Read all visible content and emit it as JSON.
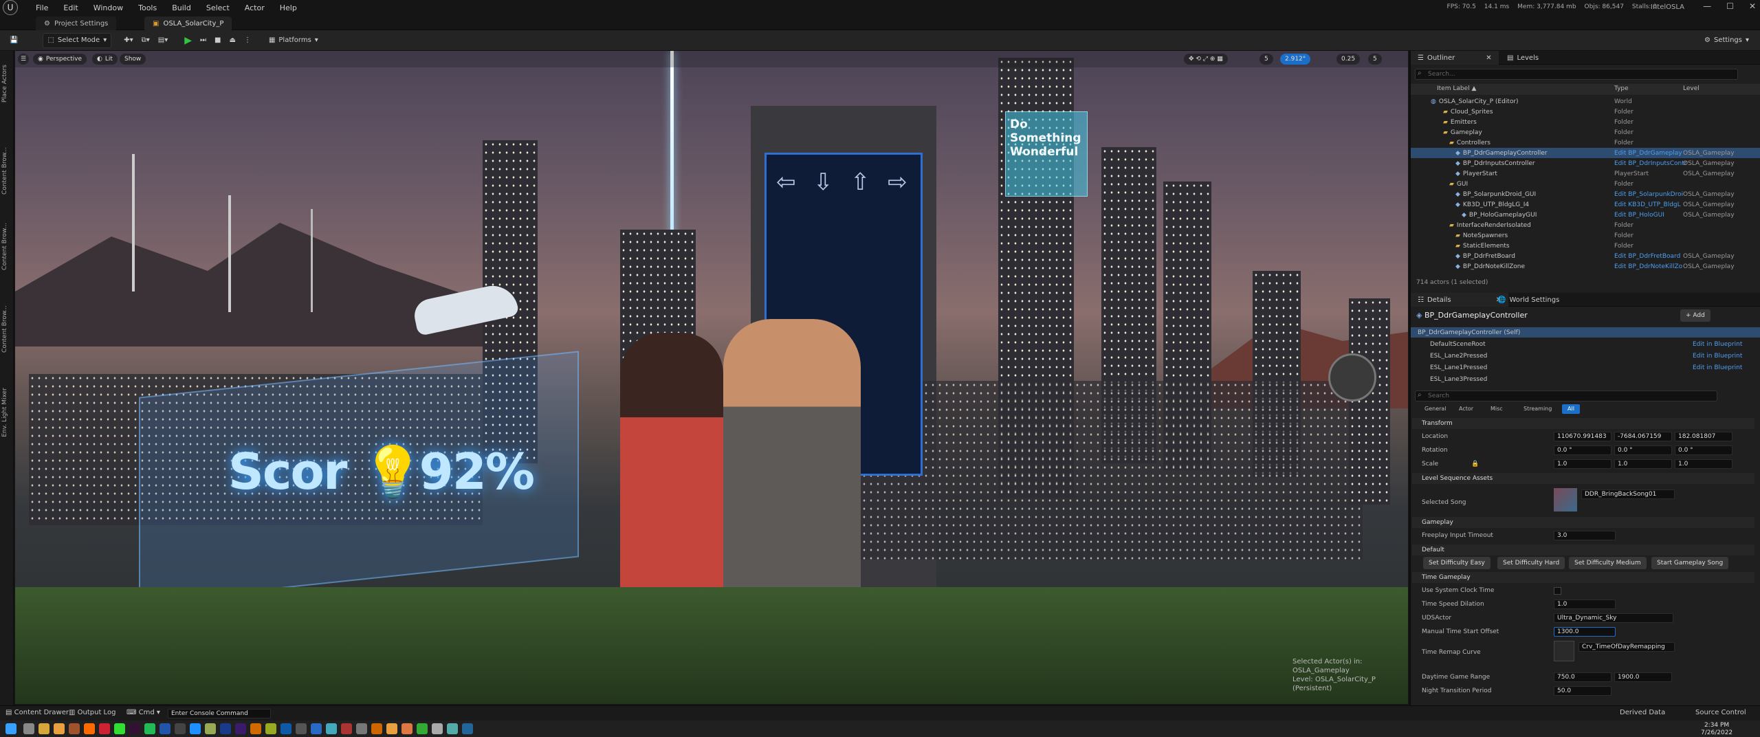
{
  "app": {
    "logo": "U",
    "menu": [
      "File",
      "Edit",
      "Window",
      "Tools",
      "Build",
      "Select",
      "Actor",
      "Help"
    ],
    "stats": [
      "FPS: 70.5",
      "14.1 ms",
      "Mem: 3,777.84 mb",
      "Objs: 86,547",
      "Stalls: 0"
    ],
    "user": "IntelOSLA",
    "controls": [
      "—",
      "☐",
      "✕"
    ]
  },
  "tabs": {
    "project_settings": "Project Settings",
    "level": "OSLA_SolarCity_P"
  },
  "toolbar": {
    "select_mode": "Select Mode",
    "platforms": "Platforms",
    "settings": "Settings"
  },
  "leftstrip": [
    "Place Actors",
    "Content Brow...",
    "Content Brow...",
    "Content Brow...",
    "Env. Light Mixer"
  ],
  "viewport": {
    "perspective": "Perspective",
    "lit": "Lit",
    "show": "Show",
    "right_controls": [
      "5",
      "2.912°",
      "0.25",
      "5"
    ],
    "billboard": [
      "Do",
      "Something",
      "Wonderful"
    ],
    "score_text": "Scor",
    "score_value": "92%",
    "arrows": [
      "⇦",
      "⇩",
      "⇧",
      "⇨"
    ],
    "status": [
      "Selected Actor(s) in:",
      "OSLA_Gameplay",
      "Level: OSLA_SolarCity_P (Persistent)"
    ]
  },
  "outliner": {
    "tab": "Outliner",
    "tab2": "Levels",
    "search_placeholder": "Search...",
    "columns": [
      "Item Label ▲",
      "Type",
      "Level"
    ],
    "rows": [
      {
        "label": "OSLA_SolarCity_P (Editor)",
        "type": "World",
        "level": "",
        "indent": 1,
        "kind": "world"
      },
      {
        "label": "Cloud_Sprites",
        "type": "Folder",
        "level": "",
        "indent": 3,
        "kind": "folder"
      },
      {
        "label": "Emitters",
        "type": "Folder",
        "level": "",
        "indent": 3,
        "kind": "folder"
      },
      {
        "label": "Gameplay",
        "type": "Folder",
        "level": "",
        "indent": 3,
        "kind": "folder"
      },
      {
        "label": "Controllers",
        "type": "Folder",
        "level": "",
        "indent": 4,
        "kind": "folder"
      },
      {
        "label": "BP_DdrGameplayController",
        "type": "Edit BP_DdrGameplay",
        "level": "OSLA_Gameplay",
        "indent": 5,
        "kind": "actor",
        "sel": true
      },
      {
        "label": "BP_DdrInputsController",
        "type": "Edit BP_DdrInputsContr",
        "level": "OSLA_Gameplay",
        "indent": 5,
        "kind": "actor"
      },
      {
        "label": "PlayerStart",
        "type": "PlayerStart",
        "level": "OSLA_Gameplay",
        "indent": 5,
        "kind": "actor"
      },
      {
        "label": "GUI",
        "type": "Folder",
        "level": "",
        "indent": 4,
        "kind": "folder"
      },
      {
        "label": "BP_SolarpunkDroid_GUI",
        "type": "Edit BP_SolarpunkDroi",
        "level": "OSLA_Gameplay",
        "indent": 5,
        "kind": "actor"
      },
      {
        "label": "KB3D_UTP_BldgLG_I4",
        "type": "Edit KB3D_UTP_BldgL",
        "level": "OSLA_Gameplay",
        "indent": 5,
        "kind": "actor"
      },
      {
        "label": "BP_HoloGameplayGUI",
        "type": "Edit BP_HoloGUI",
        "level": "OSLA_Gameplay",
        "indent": 6,
        "kind": "actor"
      },
      {
        "label": "InterfaceRenderIsolated",
        "type": "Folder",
        "level": "",
        "indent": 4,
        "kind": "folder"
      },
      {
        "label": "NoteSpawners",
        "type": "Folder",
        "level": "",
        "indent": 5,
        "kind": "folder"
      },
      {
        "label": "StaticElements",
        "type": "Folder",
        "level": "",
        "indent": 5,
        "kind": "folder"
      },
      {
        "label": "BP_DdrFretBoard",
        "type": "Edit BP_DdrFretBoard",
        "level": "OSLA_Gameplay",
        "indent": 5,
        "kind": "actor"
      },
      {
        "label": "BP_DdrNoteKillZone",
        "type": "Edit BP_DdrNoteKillZo",
        "level": "OSLA_Gameplay",
        "indent": 5,
        "kind": "actor"
      }
    ],
    "count": "714 actors (1 selected)"
  },
  "details": {
    "tab": "Details",
    "tab2": "World Settings",
    "title": "BP_DdrGameplayController",
    "add": "+ Add",
    "components": [
      {
        "label": "BP_DdrGameplayController (Self)",
        "action": ""
      },
      {
        "label": "DefaultSceneRoot",
        "action": "Edit in Blueprint"
      },
      {
        "label": "ESL_Lane2Pressed",
        "action": "Edit in Blueprint"
      },
      {
        "label": "ESL_Lane1Pressed",
        "action": "Edit in Blueprint"
      },
      {
        "label": "ESL_Lane3Pressed",
        "action": ""
      }
    ],
    "search_placeholder": "Search",
    "filters": [
      "General",
      "Actor",
      "Misc",
      "Streaming",
      "All"
    ],
    "transform": {
      "header": "Transform",
      "location_label": "Location",
      "rotation_label": "Rotation",
      "scale_label": "Scale",
      "location": [
        "110670.991483",
        "-7684.067159",
        "182.081807"
      ],
      "rotation": [
        "0.0 °",
        "0.0 °",
        "0.0 °"
      ],
      "scale": [
        "1.0",
        "1.0",
        "1.0"
      ]
    },
    "lsa": {
      "header": "Level Sequence Assets",
      "song_label": "Selected Song",
      "song_value": "DDR_BringBackSong01"
    },
    "gameplay": {
      "header": "Gameplay",
      "timeout_label": "Freeplay Input Timeout",
      "timeout_value": "3.0"
    },
    "default": {
      "header": "Default",
      "buttons": [
        "Set Difficulty Easy",
        "Set Difficulty Hard",
        "Set Difficulty Medium",
        "Start Gameplay Song"
      ]
    },
    "time": {
      "header": "Time Gameplay",
      "use_clock": "Use System Clock Time",
      "dilation_label": "Time Speed Dilation",
      "dilation_value": "1.0",
      "uds_label": "UDSActor",
      "uds_value": "Ultra_Dynamic_Sky",
      "offset_label": "Manual Time Start Offset",
      "offset_value": "1300.0",
      "curve_label": "Time Remap Curve",
      "curve_value": "Crv_TimeOfDayRemapping",
      "range_label": "Daytime Game Range",
      "range_values": [
        "750.0",
        "1900.0"
      ],
      "night_label": "Night Transition Period",
      "night_value": "50.0"
    }
  },
  "bottombar": {
    "content_drawer": "Content Drawer",
    "output_log": "Output Log",
    "cmd": "Cmd",
    "console_placeholder": "Enter Console Command",
    "derived": "Derived Data",
    "source": "Source Control"
  },
  "taskbar": {
    "time": "2:34 PM",
    "date": "7/26/2022"
  }
}
